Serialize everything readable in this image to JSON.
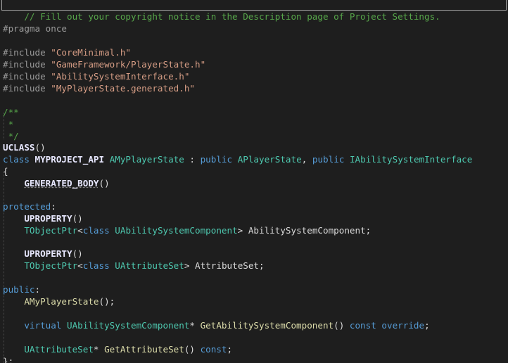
{
  "code": {
    "l1": "// Fill out your copyright notice in the Description page of Project Settings.",
    "l3_pp": "#pragma once",
    "l5_pp": "#include",
    "l5_str": "\"CoreMinimal.h\"",
    "l6_pp": "#include",
    "l6_str": "\"GameFramework/PlayerState.h\"",
    "l7_pp": "#include",
    "l7_str": "\"AbilitySystemInterface.h\"",
    "l8_pp": "#include",
    "l8_str": "\"MyPlayerState.generated.h\"",
    "l10": "/**",
    "l11": " *",
    "l12": " */",
    "l13_macro": "UCLASS",
    "l13_rest": "()",
    "l14_kw": "class",
    "l14_api": "MYPROJECT_API",
    "l14_type": "AMyPlayerState",
    "l14_colon": " : ",
    "l14_pub1": "public",
    "l14_base1": "APlayerState",
    "l14_comma": ", ",
    "l14_pub2": "public",
    "l14_base2": "IAbilitySystemInterface",
    "l15": "{",
    "l16_macro": "GENERATED_BODY",
    "l16_rest": "()",
    "l18_kw": "protected",
    "l18_rest": ":",
    "l19_macro": "UPROPERTY",
    "l19_rest": "()",
    "l20_type": "TObjectPtr",
    "l20_lt": "<",
    "l20_kw": "class",
    "l20_type2": "UAbilitySystemComponent",
    "l20_gt": "> ",
    "l20_var": "AbilitySystemComponent",
    "l20_end": ";",
    "l22_macro": "UPROPERTY",
    "l22_rest": "()",
    "l23_type": "TObjectPtr",
    "l23_lt": "<",
    "l23_kw": "class",
    "l23_type2": "UAttributeSet",
    "l23_gt": "> ",
    "l23_var": "AttributeSet",
    "l23_end": ";",
    "l25_kw": "public",
    "l25_rest": ":",
    "l26_func": "AMyPlayerState",
    "l26_rest": "();",
    "l28_kw": "virtual",
    "l28_type": "UAbilitySystemComponent",
    "l28_star": "* ",
    "l28_func": "GetAbilitySystemComponent",
    "l28_paren": "() ",
    "l28_const": "const",
    "l28_override": "override",
    "l28_end": ";",
    "l30_type": "UAttributeSet",
    "l30_star": "* ",
    "l30_func": "GetAttributeSet",
    "l30_paren": "() ",
    "l30_const": "const",
    "l30_end": ";",
    "l31": "};"
  },
  "colors": {
    "background": "#1e1e1e",
    "comment": "#57a64a",
    "preprocessor": "#9b9b9b",
    "string": "#d69d85",
    "keyword": "#569cd6",
    "type": "#4ec9b0",
    "function": "#dcdcaa",
    "macro": "#beb7ff"
  }
}
